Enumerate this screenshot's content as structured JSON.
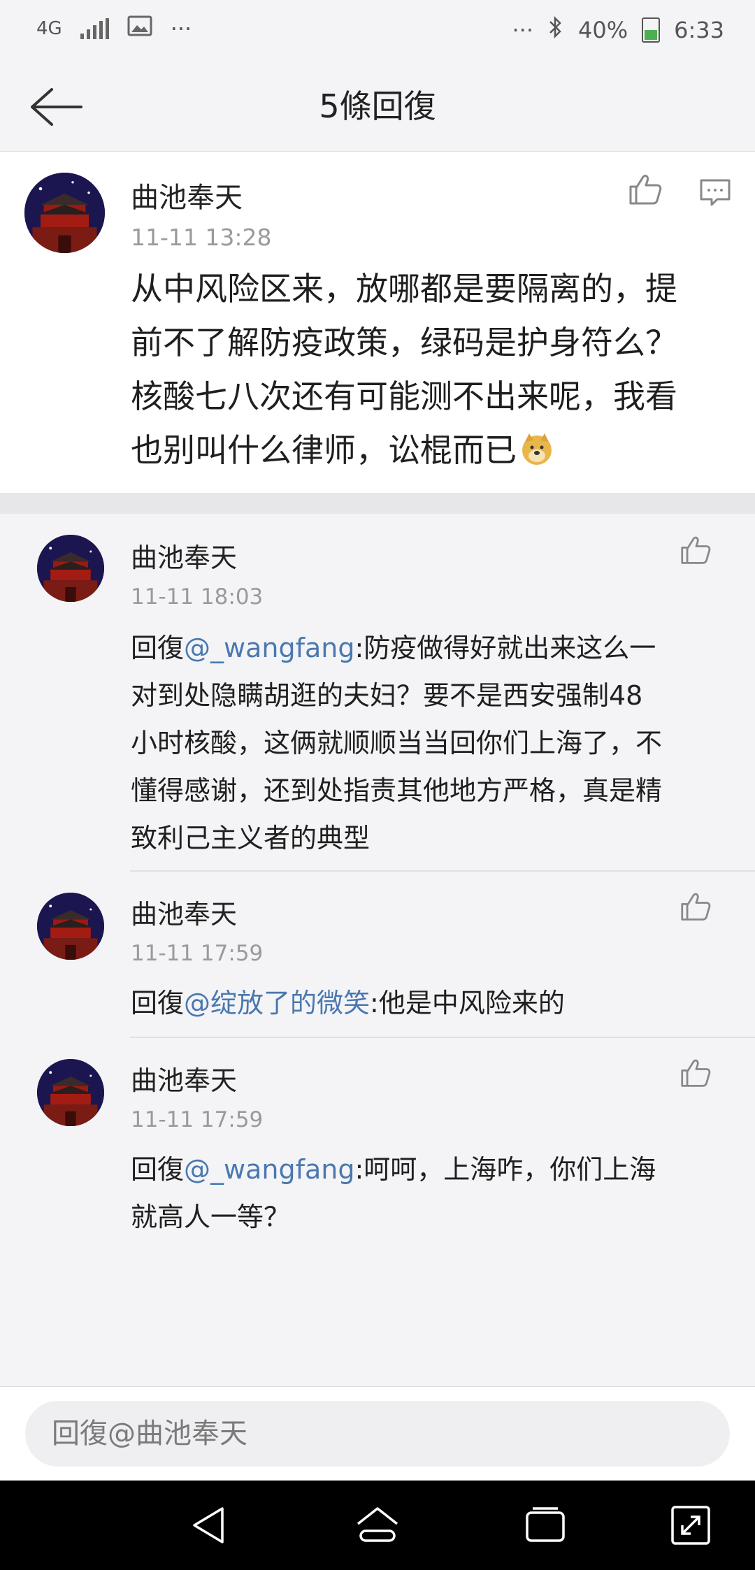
{
  "status": {
    "network": "4G",
    "more": "···",
    "more_right": "···",
    "battery": "40%",
    "time": "6:33"
  },
  "header": {
    "title": "5條回復"
  },
  "main_comment": {
    "author": "曲池奉天",
    "time": "11-11 13:28",
    "lines": [
      "从中风险区来，放哪都是要隔离的，提",
      "前不了解防疫政策，绿码是护身符么？",
      "核酸七八次还有可能测不出来呢，我看",
      "也别叫什么律师，讼棍而已"
    ]
  },
  "replies": [
    {
      "author": "曲池奉天",
      "time": "11-11 18:03",
      "prefix": "回復",
      "mention": "@_wangfang",
      "first_line_rest": ":防疫做得好就出来这么一",
      "lines": [
        "对到处隐瞒胡逛的夫妇？要不是西安强制48",
        "小时核酸，这俩就顺顺当当回你们上海了，不",
        "懂得感谢，还到处指责其他地方严格，真是精",
        "致利己主义者的典型"
      ]
    },
    {
      "author": "曲池奉天",
      "time": "11-11 17:59",
      "prefix": "回復",
      "mention": "@绽放了的微笑",
      "first_line_rest": ":他是中风险来的",
      "lines": []
    },
    {
      "author": "曲池奉天",
      "time": "11-11 17:59",
      "prefix": "回復",
      "mention": "@_wangfang",
      "first_line_rest": ":呵呵，上海咋，你们上海",
      "lines": [
        "就高人一等？"
      ]
    }
  ],
  "composer": {
    "placeholder": "回復@曲池奉天"
  },
  "icons": {
    "back": "back-arrow-icon",
    "like": "thumbs-up-icon",
    "reply": "comment-bubble-icon",
    "emoji": "doge-emoji-icon",
    "nav_back": "triangle-back-icon",
    "nav_home": "home-icon",
    "nav_recents": "recents-icon",
    "nav_expand": "expand-icon"
  },
  "colors": {
    "mention": "#4a78b0",
    "timestamp": "#9a9a9a",
    "background": "#f4f4f6"
  }
}
